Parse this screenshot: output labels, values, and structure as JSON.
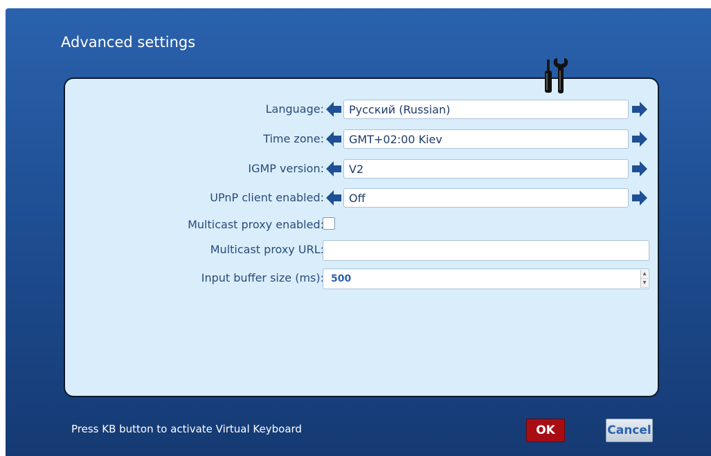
{
  "window": {
    "title": "Advanced settings"
  },
  "settings": {
    "language": {
      "label": "Language:",
      "value": "Русский (Russian)"
    },
    "time_zone": {
      "label": "Time zone:",
      "value": "GMT+02:00 Kiev"
    },
    "igmp_version": {
      "label": "IGMP version:",
      "value": "V2"
    },
    "upnp_client": {
      "label": "UPnP client enabled:",
      "value": "Off"
    },
    "multicast_proxy_enabled": {
      "label": "Multicast proxy enabled:",
      "checked": false
    },
    "multicast_proxy_url": {
      "label": "Multicast proxy URL:",
      "value": ""
    },
    "input_buffer_size": {
      "label": "Input buffer size (ms):",
      "value": "500"
    }
  },
  "footer": {
    "hint": "Press KB button to activate Virtual Keyboard",
    "ok_label": "OK",
    "cancel_label": "Cancel"
  },
  "icons": {
    "header": "tools-icon",
    "prev": "arrow-left-icon",
    "next": "arrow-right-icon"
  },
  "colors": {
    "background": "#1f4f94",
    "panel": "#d9eefa",
    "label_text": "#2a4a7a",
    "ok_button": "#a80d14",
    "arrow": "#1f4f94"
  }
}
